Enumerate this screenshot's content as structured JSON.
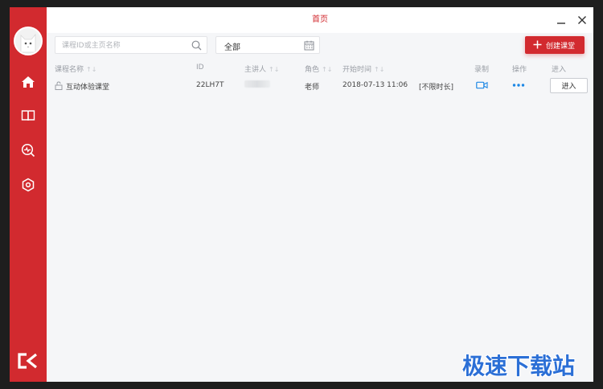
{
  "window": {
    "title": "首页"
  },
  "sidebar": {
    "items": [
      {
        "name": "home",
        "icon": "home-icon"
      },
      {
        "name": "book",
        "icon": "book-icon"
      },
      {
        "name": "stats",
        "icon": "stats-icon"
      },
      {
        "name": "settings",
        "icon": "hexagon-settings-icon"
      }
    ]
  },
  "toolbar": {
    "search_placeholder": "课程ID或主页名称",
    "filter_value": "全部",
    "create_label": "创建课堂"
  },
  "table": {
    "headers": {
      "name": "课程名称",
      "id": "ID",
      "host": "主讲人",
      "role": "角色",
      "start_time": "开始时间",
      "record": "录制",
      "action": "操作",
      "enter": "进入"
    },
    "sort_glyph": "↑↓",
    "rows": [
      {
        "name": "互动体验课堂",
        "id": "22LH7T",
        "host": "",
        "role": "老师",
        "start_time": "2018-07-13 11:06",
        "duration": "[不限时长]",
        "more": "•••",
        "enter_label": "进入"
      }
    ]
  },
  "watermark": "极速下载站",
  "colors": {
    "brand_red": "#d22a2f",
    "link_blue": "#1e88e5",
    "watermark_blue": "#2b6fd6"
  }
}
